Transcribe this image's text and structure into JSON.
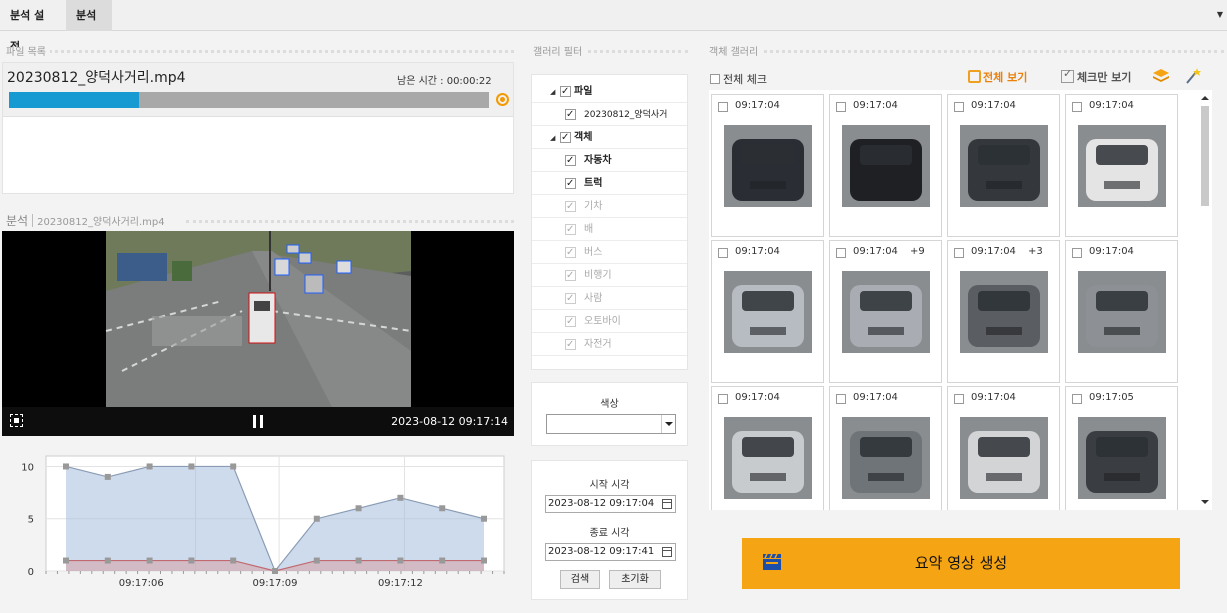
{
  "tabs": [
    {
      "label": "분석 설정"
    },
    {
      "label": "분석"
    }
  ],
  "file_list": {
    "title": "파일 목록",
    "file_name": "20230812_양덕사거리.mp4",
    "remaining": "남은 시간 : 00:00:22",
    "progress": 0.27
  },
  "analysis": {
    "title": "분석",
    "file_name": "20230812_양덕사거리.mp4",
    "video_timestamp": "2023-08-12 09:17:14"
  },
  "chart_data": {
    "type": "area",
    "x_tick_labels": [
      "09:17:06",
      "09:17:09",
      "09:17:12"
    ],
    "y_tick_labels": [
      "0",
      "5",
      "10"
    ],
    "ylim": [
      0,
      11
    ],
    "series": [
      {
        "values": [
          10,
          9,
          10,
          10,
          10,
          0,
          5,
          6,
          7,
          6,
          5
        ],
        "color": "#8a9cb5"
      },
      {
        "values": [
          1,
          1,
          1,
          1,
          1,
          0,
          1,
          1,
          1,
          1,
          1
        ],
        "color": "#c06a70"
      }
    ]
  },
  "filter": {
    "title": "갤러리 필터",
    "file_group": "파일",
    "file_item": "20230812_양덕사거",
    "object_group": "객체",
    "objects": [
      {
        "label": "자동차",
        "enabled": true
      },
      {
        "label": "트럭",
        "enabled": true
      },
      {
        "label": "기차",
        "enabled": false
      },
      {
        "label": "배",
        "enabled": false
      },
      {
        "label": "버스",
        "enabled": false
      },
      {
        "label": "비행기",
        "enabled": false
      },
      {
        "label": "사람",
        "enabled": false
      },
      {
        "label": "오토바이",
        "enabled": false
      },
      {
        "label": "자전거",
        "enabled": false
      }
    ],
    "color_label": "색상",
    "start_label": "시작 시각",
    "start_value": "2023-08-12 09:17:04",
    "end_label": "종료 시각",
    "end_value": "2023-08-12 09:17:41",
    "search_button": "검색",
    "reset_button": "초기화"
  },
  "gallery": {
    "title": "객체 갤러리",
    "select_all": "전체 체크",
    "view_all": "전체 보기",
    "view_checked": "체크만 보기",
    "items": [
      {
        "time": "09:17:04",
        "extra": "",
        "color": "#2a2d33"
      },
      {
        "time": "09:17:04",
        "extra": "",
        "color": "#1f2024"
      },
      {
        "time": "09:17:04",
        "extra": "",
        "color": "#34383d"
      },
      {
        "time": "09:17:04",
        "extra": "",
        "color": "#e4e4e4"
      },
      {
        "time": "09:17:04",
        "extra": "",
        "color": "#b7bcc2"
      },
      {
        "time": "09:17:04",
        "extra": "+9",
        "color": "#a9adb3"
      },
      {
        "time": "09:17:04",
        "extra": "+3",
        "color": "#5a5e63"
      },
      {
        "time": "09:17:04",
        "extra": "",
        "color": "#8d9195"
      },
      {
        "time": "09:17:04",
        "extra": "",
        "color": "#c8cbce"
      },
      {
        "time": "09:17:04",
        "extra": "",
        "color": "#6f7478"
      },
      {
        "time": "09:17:04",
        "extra": "",
        "color": "#d3d4d6"
      },
      {
        "time": "09:17:05",
        "extra": "",
        "color": "#3a3d42"
      }
    ],
    "summary_button": "요약 영상 생성"
  }
}
